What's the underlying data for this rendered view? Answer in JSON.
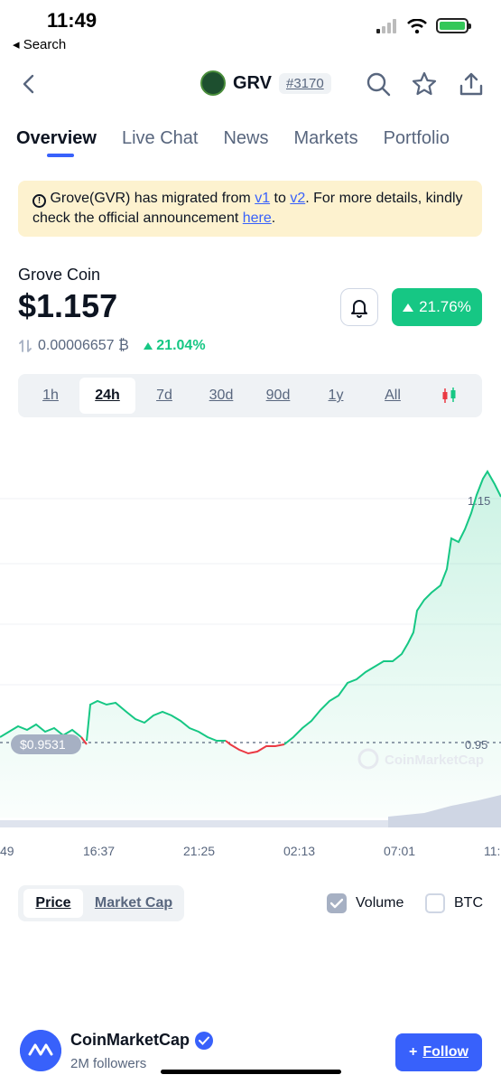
{
  "status": {
    "time": "11:49",
    "back_label": "◂ Search"
  },
  "header": {
    "symbol": "GRV",
    "rank": "#3170"
  },
  "tabs": [
    "Overview",
    "Live Chat",
    "News",
    "Markets",
    "Portfolio"
  ],
  "notice": {
    "text1": "Grove(GVR) has migrated from ",
    "link_v1": "v1",
    "text2": " to ",
    "link_v2": "v2",
    "text3": ". For more details, kindly check the official announcement ",
    "link_here": "here",
    "text4": "."
  },
  "coin": {
    "name": "Grove Coin",
    "price": "$1.157",
    "change_24h": "21.76%",
    "btc_price": "0.00006657 ₿",
    "btc_change": "21.04%"
  },
  "ranges": [
    "1h",
    "24h",
    "7d",
    "30d",
    "90d",
    "1y",
    "All"
  ],
  "active_range": "24h",
  "chart": {
    "price_tag": "$0.9531",
    "y_labels": [
      "1.15",
      "0.95"
    ],
    "x_labels": [
      "49",
      "16:37",
      "21:25",
      "02:13",
      "07:01",
      "11:"
    ],
    "watermark": "CoinMarketCap"
  },
  "chart_toggles": {
    "price": "Price",
    "market_cap": "Market Cap",
    "volume": "Volume",
    "btc": "BTC",
    "volume_checked": true,
    "btc_checked": false
  },
  "follow": {
    "name": "CoinMarketCap",
    "followers": "2M followers",
    "button": "Follow"
  },
  "colors": {
    "up": "#16c784",
    "down": "#ea3943",
    "accent": "#3861fb"
  },
  "icons": [
    "back-icon",
    "search-icon",
    "star-icon",
    "share-icon",
    "bell-icon",
    "candlestick-icon",
    "checkmark-icon"
  ]
}
